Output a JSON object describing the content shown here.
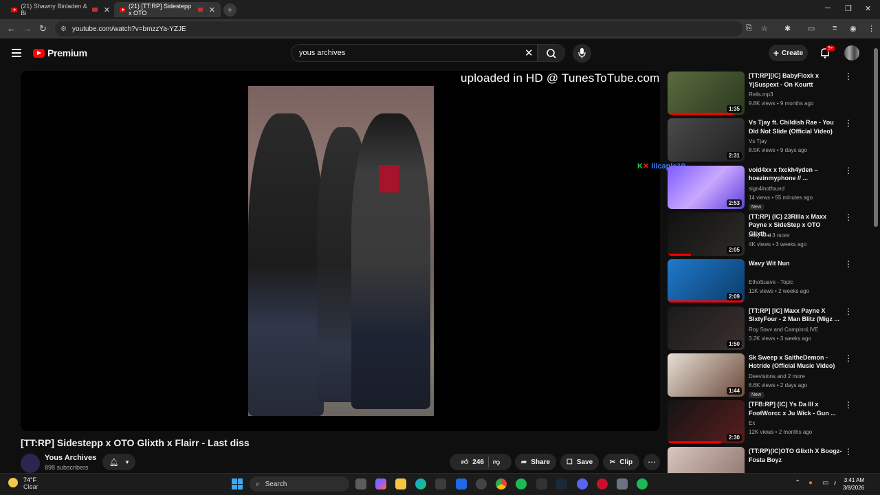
{
  "browser": {
    "tabs": [
      {
        "label": "(21) Shawny Binladen & Bi"
      },
      {
        "label": "(21) [TT:RP] Sidestepp x OTO"
      }
    ],
    "url": "youtube.com/watch?v=bmzzYa-YZJE"
  },
  "header": {
    "logo_text": "Premium",
    "search_value": "yous archives",
    "create_label": "Create",
    "notification_count": "9+"
  },
  "video": {
    "watermark": "uploaded in HD @ TunesToTube.com",
    "side_tag": "liicaple19",
    "title": "[TT:RP] Sidestepp x OTO Glixth x Flairr - Last diss",
    "channel_name": "Yous Archives",
    "subscribers": "898 subscribers",
    "likes": "246",
    "share_label": "Share",
    "save_label": "Save",
    "clip_label": "Clip"
  },
  "recommendations": [
    {
      "title": "[TT:RP][IC] BabyFloxk x YjSuspext - On Kourtt",
      "channel": "Reils.mp3",
      "meta": "9.8K views • 9 months ago",
      "duration": "1:35",
      "progress": 0.85,
      "new": ""
    },
    {
      "title": "Vs Tjay ft. Childish Rae - You Did Not Slide (Official Video)",
      "channel": "Vs Tjay",
      "meta": "8.5K views • 9 days ago",
      "duration": "2:31",
      "progress": 0,
      "new": ""
    },
    {
      "title": "void4xx x fxckh4yden – hoezinmyphone // ...",
      "channel": "sign4lnotfound",
      "meta": "14 views • 55 minutes ago",
      "duration": "2:53",
      "progress": 0,
      "new": "New"
    },
    {
      "title": "(TT:RP) (IC) 23Rilla x Maxx Payne x SideStep x OTO Glixth...",
      "channel": "zkay and 3 more",
      "meta": "4K views • 3 weeks ago",
      "duration": "2:05",
      "progress": 0.3,
      "new": ""
    },
    {
      "title": "Wavy Wit Nun",
      "channel": "EthoSuave - Topic",
      "meta": "11K views • 2 weeks ago",
      "duration": "2:09",
      "progress": 1.0,
      "new": ""
    },
    {
      "title": "[TT:RP] [IC] Maxx Payne X SixtyFour - 2 Man Blitz (Migz ...",
      "channel": "Roy Savv and CampinoLIVE",
      "meta": "3.2K views • 3 weeks ago",
      "duration": "1:50",
      "progress": 0,
      "new": ""
    },
    {
      "title": "Sk Sweep x SaitheDemon - Hotride (Official Music Video)",
      "channel": "Deevisions and 2 more",
      "meta": "6.6K views • 2 days ago",
      "duration": "1:44",
      "progress": 0,
      "new": "New"
    },
    {
      "title": "[TFB:RP] (IC) Ys Da III x FootWorcc x Ju Wick - Gun ...",
      "channel": "Ex",
      "meta": "12K views • 2 months ago",
      "duration": "2:30",
      "progress": 0.7,
      "new": ""
    },
    {
      "title": "(TT:RP)(IC)OTO Glixth X Boogz-Fosta Boyz",
      "channel": "",
      "meta": "",
      "duration": "",
      "progress": 0,
      "new": ""
    }
  ],
  "taskbar": {
    "temperature": "74°F",
    "condition": "Clear",
    "search_label": "Search",
    "time": "3:41 AM",
    "date": "3/8/2026"
  }
}
